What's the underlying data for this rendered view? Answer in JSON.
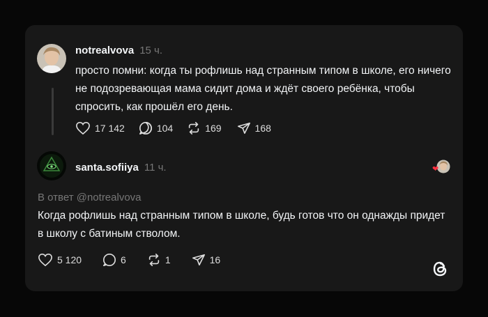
{
  "post1": {
    "username": "notrealvova",
    "time": "15 ч.",
    "text": "просто помни: когда ты рофлишь над странным типом в школе, его ничего не подозревающая мама сидит дома и ждёт своего ребёнка, чтобы спросить, как прошёл его день.",
    "likes": "17 142",
    "comments": "104",
    "reposts": "169",
    "shares": "168"
  },
  "post2": {
    "username": "santa.sofiiya",
    "time": "11 ч.",
    "reply_to": "В ответ @notrealvova",
    "text": "Когда рофлишь над странным типом в школе, будь готов что он однажды придет в школу с батиным стволом.",
    "likes": "5 120",
    "comments": "6",
    "reposts": "1",
    "shares": "16"
  },
  "icons": {
    "like": "heart-outline-icon",
    "comment": "comment-bubble-icon",
    "repost": "repost-arrows-icon",
    "share": "paper-plane-icon",
    "logo": "threads-logo-icon",
    "liked_badge": "red-heart-icon"
  },
  "colors": {
    "background": "#070707",
    "card": "#181818",
    "text": "#f3f5f7",
    "muted": "#777777",
    "heart": "#ff3040"
  }
}
